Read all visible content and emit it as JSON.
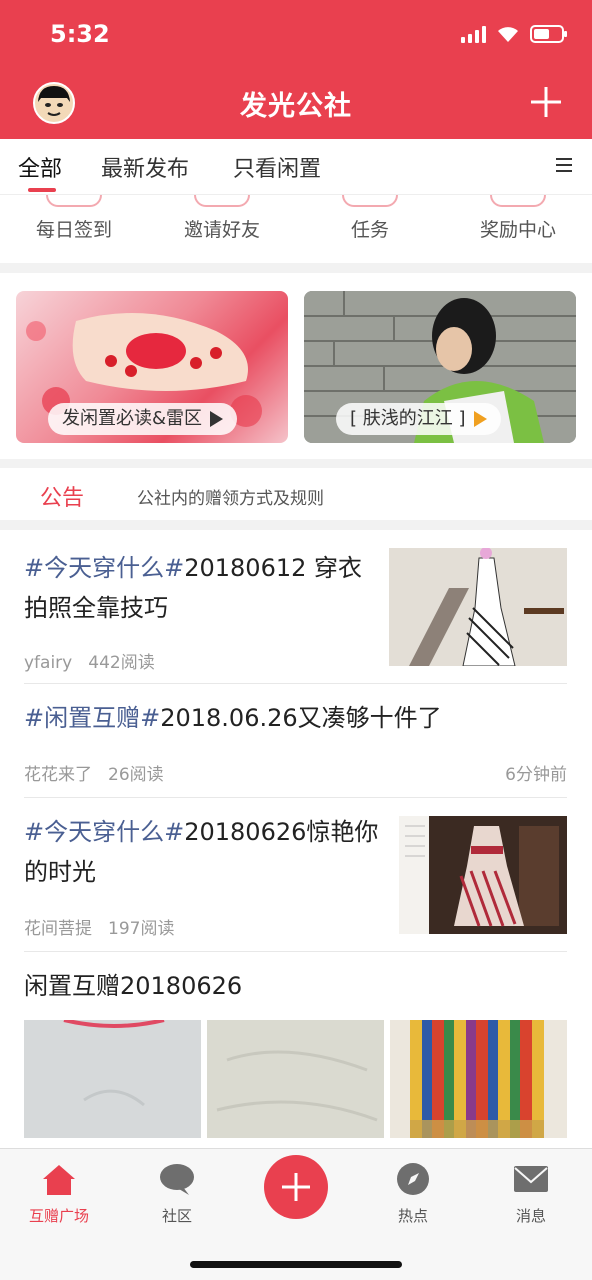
{
  "status": {
    "time": "5:32"
  },
  "header": {
    "title": "发光公社"
  },
  "tabs": [
    {
      "label": "全部"
    },
    {
      "label": "最新发布"
    },
    {
      "label": "只看闲置"
    }
  ],
  "shortcuts": [
    {
      "label": "每日签到"
    },
    {
      "label": "邀请好友"
    },
    {
      "label": "任务"
    },
    {
      "label": "奖励中心"
    }
  ],
  "banners": [
    {
      "label": "发闲置必读&雷区"
    },
    {
      "label": "[ 肤浅的江江 ]"
    }
  ],
  "notice": {
    "title": "公告",
    "text": "公社内的赠领方式及规则"
  },
  "feed": [
    {
      "hashtag": "#今天穿什么#",
      "title": "20180612 穿衣拍照全靠技巧",
      "author": "yfairy",
      "reads": "442阅读",
      "time": ""
    },
    {
      "hashtag": "#闲置互赠#",
      "title": "2018.06.26又凑够十件了",
      "author": "花花来了",
      "reads": "26阅读",
      "time": "6分钟前"
    },
    {
      "hashtag": "#今天穿什么#",
      "title": "20180626惊艳你的时光",
      "author": "花间菩提",
      "reads": "197阅读",
      "time": ""
    },
    {
      "hashtag": "",
      "title": "闲置互赠20180626",
      "author": "",
      "reads": "",
      "time": ""
    }
  ],
  "tabbar": [
    {
      "label": "互赠广场",
      "icon": "home-icon"
    },
    {
      "label": "社区",
      "icon": "chat-icon"
    },
    {
      "label": "",
      "icon": "plus-icon"
    },
    {
      "label": "热点",
      "icon": "compass-icon"
    },
    {
      "label": "消息",
      "icon": "mail-icon"
    }
  ],
  "colors": {
    "brand": "#e9404f",
    "hashtag": "#4a5f92"
  }
}
